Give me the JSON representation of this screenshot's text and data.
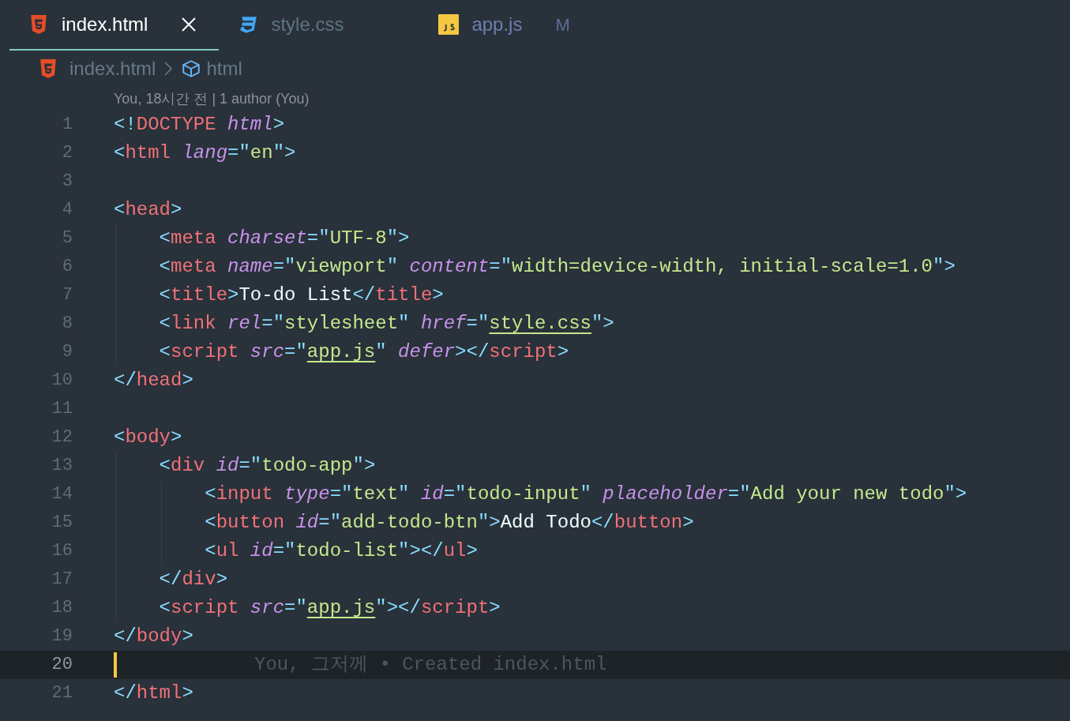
{
  "tabs": [
    {
      "label": "index.html",
      "kind": "html",
      "selected": true,
      "closable": true
    },
    {
      "label": "style.css",
      "kind": "css",
      "selected": false,
      "closable": false
    },
    {
      "label": "app.js",
      "kind": "js",
      "selected": false,
      "closable": false,
      "status": "M"
    }
  ],
  "breadcrumb": [
    {
      "label": "index.html",
      "kind": "html"
    },
    {
      "label": "html",
      "kind": "element"
    }
  ],
  "blame_header": "You, 18시간 전 | 1 author (You)",
  "lines": [
    {
      "number": "1",
      "selected": false,
      "tokens": [
        {
          "kind": "punct",
          "text": "<!"
        },
        {
          "kind": "tag",
          "text": "DOCTYPE"
        },
        {
          "kind": "attr",
          "text": " html"
        },
        {
          "kind": "punct",
          "text": ">"
        }
      ]
    },
    {
      "number": "2",
      "selected": false,
      "tokens": [
        {
          "kind": "punct",
          "text": "<"
        },
        {
          "kind": "tag",
          "text": "html"
        },
        {
          "kind": "attr",
          "text": " lang"
        },
        {
          "kind": "punct",
          "text": "=\""
        },
        {
          "kind": "string",
          "text": "en"
        },
        {
          "kind": "punct",
          "text": "\">"
        }
      ]
    },
    {
      "number": "3",
      "selected": false
    },
    {
      "number": "4",
      "selected": false,
      "tokens": [
        {
          "kind": "punct",
          "text": "<"
        },
        {
          "kind": "tag",
          "text": "head"
        },
        {
          "kind": "punct",
          "text": ">"
        }
      ]
    },
    {
      "number": "5",
      "selected": false,
      "tokens": [
        {
          "kind": "punct",
          "text": "    <"
        },
        {
          "kind": "tag",
          "text": "meta"
        },
        {
          "kind": "attr",
          "text": " charset"
        },
        {
          "kind": "punct",
          "text": "=\""
        },
        {
          "kind": "string",
          "text": "UTF-8"
        },
        {
          "kind": "punct",
          "text": "\">"
        }
      ]
    },
    {
      "number": "6",
      "selected": false,
      "tokens": [
        {
          "kind": "punct",
          "text": "    <"
        },
        {
          "kind": "tag",
          "text": "meta"
        },
        {
          "kind": "attr",
          "text": " name"
        },
        {
          "kind": "punct",
          "text": "=\""
        },
        {
          "kind": "string",
          "text": "viewport"
        },
        {
          "kind": "punct",
          "text": "\""
        },
        {
          "kind": "attr",
          "text": " content"
        },
        {
          "kind": "punct",
          "text": "=\""
        },
        {
          "kind": "string",
          "text": "width=device-width, initial-scale=1.0"
        },
        {
          "kind": "punct",
          "text": "\">"
        }
      ]
    },
    {
      "number": "7",
      "selected": false,
      "tokens": [
        {
          "kind": "punct",
          "text": "    <"
        },
        {
          "kind": "tag",
          "text": "title"
        },
        {
          "kind": "punct",
          "text": ">"
        },
        {
          "kind": "text",
          "text": "To-do List"
        },
        {
          "kind": "punct",
          "text": "</"
        },
        {
          "kind": "tag",
          "text": "title"
        },
        {
          "kind": "punct",
          "text": ">"
        }
      ]
    },
    {
      "number": "8",
      "selected": false,
      "tokens": [
        {
          "kind": "punct",
          "text": "    <"
        },
        {
          "kind": "tag",
          "text": "link"
        },
        {
          "kind": "attr",
          "text": " rel"
        },
        {
          "kind": "punct",
          "text": "=\""
        },
        {
          "kind": "string",
          "text": "stylesheet"
        },
        {
          "kind": "punct",
          "text": "\""
        },
        {
          "kind": "attr",
          "text": " href"
        },
        {
          "kind": "punct",
          "text": "=\""
        },
        {
          "kind": "link",
          "text": "style.css"
        },
        {
          "kind": "punct",
          "text": "\">"
        }
      ]
    },
    {
      "number": "9",
      "selected": false,
      "tokens": [
        {
          "kind": "punct",
          "text": "    <"
        },
        {
          "kind": "tag",
          "text": "script"
        },
        {
          "kind": "attr",
          "text": " src"
        },
        {
          "kind": "punct",
          "text": "=\""
        },
        {
          "kind": "link",
          "text": "app.js"
        },
        {
          "kind": "punct",
          "text": "\""
        },
        {
          "kind": "attr",
          "text": " defer"
        },
        {
          "kind": "punct",
          "text": "></"
        },
        {
          "kind": "tag",
          "text": "script"
        },
        {
          "kind": "punct",
          "text": ">"
        }
      ]
    },
    {
      "number": "10",
      "selected": false,
      "tokens": [
        {
          "kind": "punct",
          "text": "</"
        },
        {
          "kind": "tag",
          "text": "head"
        },
        {
          "kind": "punct",
          "text": ">"
        }
      ]
    },
    {
      "number": "11",
      "selected": false
    },
    {
      "number": "12",
      "selected": false,
      "tokens": [
        {
          "kind": "punct",
          "text": "<"
        },
        {
          "kind": "tag",
          "text": "body"
        },
        {
          "kind": "punct",
          "text": ">"
        }
      ]
    },
    {
      "number": "13",
      "selected": false,
      "tokens": [
        {
          "kind": "punct",
          "text": "    <"
        },
        {
          "kind": "tag",
          "text": "div"
        },
        {
          "kind": "attr",
          "text": " id"
        },
        {
          "kind": "punct",
          "text": "=\""
        },
        {
          "kind": "string",
          "text": "todo-app"
        },
        {
          "kind": "punct",
          "text": "\">"
        }
      ]
    },
    {
      "number": "14",
      "selected": false,
      "tokens": [
        {
          "kind": "punct",
          "text": "        <"
        },
        {
          "kind": "tag",
          "text": "input"
        },
        {
          "kind": "attr",
          "text": " type"
        },
        {
          "kind": "punct",
          "text": "=\""
        },
        {
          "kind": "string",
          "text": "text"
        },
        {
          "kind": "punct",
          "text": "\""
        },
        {
          "kind": "attr",
          "text": " id"
        },
        {
          "kind": "punct",
          "text": "=\""
        },
        {
          "kind": "string",
          "text": "todo-input"
        },
        {
          "kind": "punct",
          "text": "\""
        },
        {
          "kind": "attr",
          "text": " placeholder"
        },
        {
          "kind": "punct",
          "text": "=\""
        },
        {
          "kind": "string",
          "text": "Add your new todo"
        },
        {
          "kind": "punct",
          "text": "\">"
        }
      ]
    },
    {
      "number": "15",
      "selected": false,
      "tokens": [
        {
          "kind": "punct",
          "text": "        <"
        },
        {
          "kind": "tag",
          "text": "button"
        },
        {
          "kind": "attr",
          "text": " id"
        },
        {
          "kind": "punct",
          "text": "=\""
        },
        {
          "kind": "string",
          "text": "add-todo-btn"
        },
        {
          "kind": "punct",
          "text": "\">"
        },
        {
          "kind": "text",
          "text": "Add Todo"
        },
        {
          "kind": "punct",
          "text": "</"
        },
        {
          "kind": "tag",
          "text": "button"
        },
        {
          "kind": "punct",
          "text": ">"
        }
      ]
    },
    {
      "number": "16",
      "selected": false,
      "tokens": [
        {
          "kind": "punct",
          "text": "        <"
        },
        {
          "kind": "tag",
          "text": "ul"
        },
        {
          "kind": "attr",
          "text": " id"
        },
        {
          "kind": "punct",
          "text": "=\""
        },
        {
          "kind": "string",
          "text": "todo-list"
        },
        {
          "kind": "punct",
          "text": "\"></"
        },
        {
          "kind": "tag",
          "text": "ul"
        },
        {
          "kind": "punct",
          "text": ">"
        }
      ]
    },
    {
      "number": "17",
      "selected": false,
      "tokens": [
        {
          "kind": "punct",
          "text": "    </"
        },
        {
          "kind": "tag",
          "text": "div"
        },
        {
          "kind": "punct",
          "text": ">"
        }
      ]
    },
    {
      "number": "18",
      "selected": false,
      "tokens": [
        {
          "kind": "punct",
          "text": "    <"
        },
        {
          "kind": "tag",
          "text": "script"
        },
        {
          "kind": "attr",
          "text": " src"
        },
        {
          "kind": "punct",
          "text": "=\""
        },
        {
          "kind": "link",
          "text": "app.js"
        },
        {
          "kind": "punct",
          "text": "\"></"
        },
        {
          "kind": "tag",
          "text": "script"
        },
        {
          "kind": "punct",
          "text": ">"
        }
      ]
    },
    {
      "number": "19",
      "selected": false,
      "tokens": [
        {
          "kind": "punct",
          "text": "</"
        },
        {
          "kind": "tag",
          "text": "body"
        },
        {
          "kind": "punct",
          "text": ">"
        }
      ]
    },
    {
      "number": "20",
      "selected": true,
      "blame": "You, 그저께 • Created index.html"
    },
    {
      "number": "21",
      "selected": false,
      "tokens": [
        {
          "kind": "punct",
          "text": "</"
        },
        {
          "kind": "tag",
          "text": "html"
        },
        {
          "kind": "punct",
          "text": ">"
        }
      ]
    }
  ]
}
